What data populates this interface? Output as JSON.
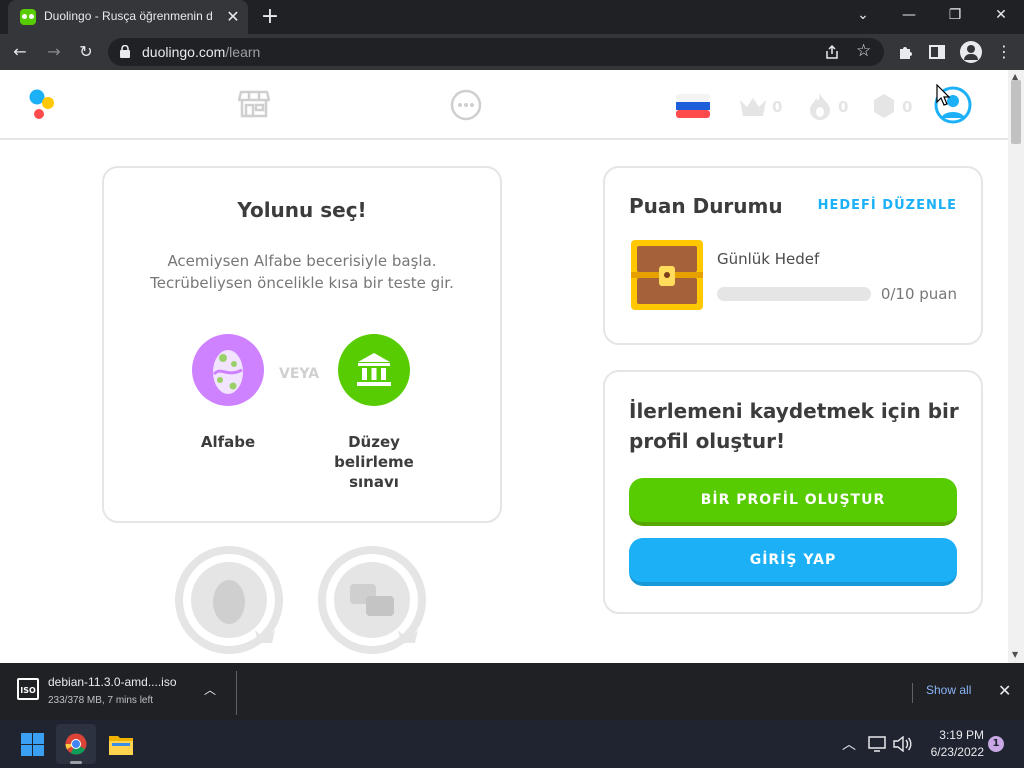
{
  "browser": {
    "tab_title": "Duolingo - Rusça öğrenmenin d",
    "url_host": "duolingo.com",
    "url_path": "/learn"
  },
  "nav": {
    "crowns": "0",
    "streak": "0",
    "gems": "0"
  },
  "choose": {
    "title": "Yolunu seç!",
    "subtitle_line1": "Acemiysen Alfabe becerisiyle başla.",
    "subtitle_line2": "Tecrübeliysen öncelikle kısa bir teste gir.",
    "or": "VEYA",
    "option1": "Alfabe",
    "option2_line1": "Düzey",
    "option2_line2": "belirleme",
    "option2_line3": "sınavı"
  },
  "score": {
    "title": "Puan Durumu",
    "edit": "HEDEFİ DÜZENLE",
    "goal_label": "Günlük Hedef",
    "progress_text": "0/10 puan",
    "progress_fraction": 0
  },
  "profile": {
    "title_line1": "İlerlemeni kaydetmek için bir",
    "title_line2": "profil oluştur!",
    "create_button": "BİR PROFİL OLUŞTUR",
    "login_button": "GİRİŞ YAP"
  },
  "download": {
    "file": "debian-11.3.0-amd....iso",
    "status": "233/378 MB, 7 mins left",
    "show_all": "Show all"
  },
  "taskbar": {
    "time": "3:19 PM",
    "date": "6/23/2022",
    "notifications": "1"
  },
  "colors": {
    "green": "#58cc02",
    "blue": "#1cb0f6",
    "purple": "#ce82ff",
    "gray_text": "#777777"
  }
}
